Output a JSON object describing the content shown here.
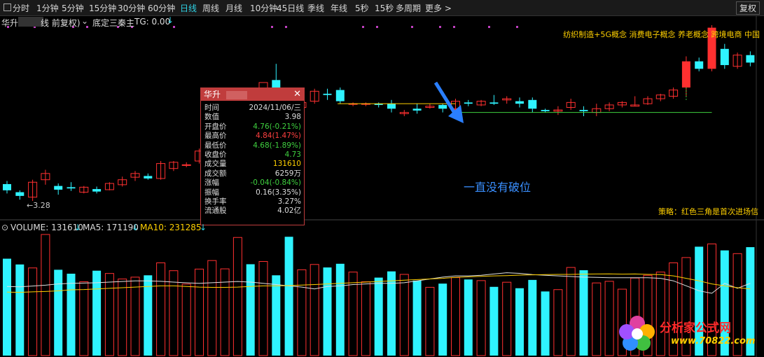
{
  "toolbar": {
    "periods": [
      "分时",
      "1分钟",
      "5分钟",
      "15分钟",
      "30分钟",
      "60分钟",
      "日线",
      "周线",
      "月线",
      "10分钟",
      "45日线",
      "季线",
      "年线",
      "5秒",
      "15秒",
      "多周期",
      "更多 >"
    ],
    "active": "日线",
    "right_button": "复权"
  },
  "header": {
    "name": "华升",
    "mode": "线 前复权)",
    "indicator": "底定三秦主",
    "tg": "TG: 0.00"
  },
  "concepts": "纺织制造+5G概念 消费电子概念 养老概念 跨境电商 中国",
  "strategy": "策略：红色三角是首次进场信",
  "annotation": "一直没有破位",
  "low_label": "3.28",
  "tooltip": {
    "title": "华升",
    "rows": [
      {
        "label": "时间",
        "value": "2024/11/06/三",
        "color": "#dddddd"
      },
      {
        "label": "数值",
        "value": "3.98",
        "color": "#dddddd"
      },
      {
        "label": "开盘价",
        "value": "4.76(-0.21%)",
        "color": "#3fd13f"
      },
      {
        "label": "最高价",
        "value": "4.84(1.47%)",
        "color": "#ff4040"
      },
      {
        "label": "最低价",
        "value": "4.68(-1.89%)",
        "color": "#3fd13f"
      },
      {
        "label": "收盘价",
        "value": "4.73",
        "color": "#3fd13f"
      },
      {
        "label": "成交量",
        "value": "131610",
        "color": "#ffd000"
      },
      {
        "label": "成交额",
        "value": "6259万",
        "color": "#dddddd"
      },
      {
        "label": "涨幅",
        "value": "-0.04(-0.84%)",
        "color": "#3fd13f"
      },
      {
        "label": "振幅",
        "value": "0.16(3.35%)",
        "color": "#dddddd"
      },
      {
        "label": "换手率",
        "value": "3.27%",
        "color": "#dddddd"
      },
      {
        "label": "流通股",
        "value": "4.02亿",
        "color": "#dddddd"
      }
    ]
  },
  "volume_header": {
    "volume": "VOLUME: 131610",
    "ma5": "MA5: 171190",
    "ma10": "MA10: 231285"
  },
  "logo": {
    "text": "分析家公式网",
    "url": "www.70822.com"
  },
  "colors": {
    "up": "#ff3030",
    "down": "#2ff3ff",
    "accent": "#2fd3e6",
    "yellow": "#ffd000"
  },
  "chart_data": {
    "type": "candlestick",
    "candles": [
      {
        "o": 3.55,
        "h": 3.6,
        "l": 3.4,
        "c": 3.45
      },
      {
        "o": 3.42,
        "h": 3.45,
        "l": 3.3,
        "c": 3.36
      },
      {
        "o": 3.34,
        "h": 3.62,
        "l": 3.28,
        "c": 3.58
      },
      {
        "o": 3.62,
        "h": 3.78,
        "l": 3.54,
        "c": 3.72
      },
      {
        "o": 3.52,
        "h": 3.56,
        "l": 3.38,
        "c": 3.46
      },
      {
        "o": 3.5,
        "h": 3.58,
        "l": 3.44,
        "c": 3.48
      },
      {
        "o": 3.42,
        "h": 3.52,
        "l": 3.4,
        "c": 3.5
      },
      {
        "o": 3.47,
        "h": 3.51,
        "l": 3.4,
        "c": 3.43
      },
      {
        "o": 3.46,
        "h": 3.58,
        "l": 3.45,
        "c": 3.56
      },
      {
        "o": 3.54,
        "h": 3.67,
        "l": 3.51,
        "c": 3.62
      },
      {
        "o": 3.66,
        "h": 3.76,
        "l": 3.6,
        "c": 3.72
      },
      {
        "o": 3.68,
        "h": 3.72,
        "l": 3.62,
        "c": 3.64
      },
      {
        "o": 3.64,
        "h": 3.92,
        "l": 3.62,
        "c": 3.88
      },
      {
        "o": 3.8,
        "h": 3.92,
        "l": 3.76,
        "c": 3.9
      },
      {
        "o": 3.86,
        "h": 3.9,
        "l": 3.82,
        "c": 3.86
      },
      {
        "o": 3.92,
        "h": 4.12,
        "l": 3.88,
        "c": 4.08
      },
      {
        "o": 4.35,
        "h": 4.62,
        "l": 4.3,
        "c": 4.56
      },
      {
        "o": 4.56,
        "h": 4.64,
        "l": 4.52,
        "c": 4.6
      },
      {
        "o": 4.6,
        "h": 4.98,
        "l": 4.56,
        "c": 4.92
      },
      {
        "o": 4.9,
        "h": 5.02,
        "l": 4.66,
        "c": 4.72
      },
      {
        "o": 4.68,
        "h": 5.02,
        "l": 4.5,
        "c": 5.18
      },
      {
        "o": 5.22,
        "h": 5.48,
        "l": 4.78,
        "c": 4.84
      },
      {
        "o": 4.8,
        "h": 4.86,
        "l": 4.7,
        "c": 4.74
      },
      {
        "o": 4.78,
        "h": 4.9,
        "l": 4.72,
        "c": 4.86
      },
      {
        "o": 4.88,
        "h": 5.08,
        "l": 4.84,
        "c": 5.04
      },
      {
        "o": 5.0,
        "h": 5.08,
        "l": 4.9,
        "c": 4.98
      },
      {
        "o": 5.06,
        "h": 5.1,
        "l": 4.84,
        "c": 4.88
      },
      {
        "o": 4.84,
        "h": 4.86,
        "l": 4.8,
        "c": 4.84
      },
      {
        "o": 4.84,
        "h": 4.86,
        "l": 4.8,
        "c": 4.84
      },
      {
        "o": 4.84,
        "h": 4.86,
        "l": 4.78,
        "c": 4.82
      },
      {
        "o": 4.84,
        "h": 4.9,
        "l": 4.7,
        "c": 4.76
      },
      {
        "o": 4.68,
        "h": 4.74,
        "l": 4.64,
        "c": 4.7
      },
      {
        "o": 4.76,
        "h": 4.84,
        "l": 4.68,
        "c": 4.73
      },
      {
        "o": 4.78,
        "h": 4.84,
        "l": 4.76,
        "c": 4.8
      },
      {
        "o": 4.82,
        "h": 4.84,
        "l": 4.7,
        "c": 4.76
      },
      {
        "o": 4.76,
        "h": 4.92,
        "l": 4.74,
        "c": 4.88
      },
      {
        "o": 4.86,
        "h": 4.9,
        "l": 4.8,
        "c": 4.84
      },
      {
        "o": 4.82,
        "h": 4.9,
        "l": 4.8,
        "c": 4.88
      },
      {
        "o": 4.86,
        "h": 4.98,
        "l": 4.82,
        "c": 4.84
      },
      {
        "o": 4.9,
        "h": 4.96,
        "l": 4.84,
        "c": 4.92
      },
      {
        "o": 4.88,
        "h": 4.94,
        "l": 4.78,
        "c": 4.84
      },
      {
        "o": 4.9,
        "h": 4.94,
        "l": 4.7,
        "c": 4.76
      },
      {
        "o": 4.74,
        "h": 4.76,
        "l": 4.7,
        "c": 4.72
      },
      {
        "o": 4.72,
        "h": 4.8,
        "l": 4.66,
        "c": 4.74
      },
      {
        "o": 4.78,
        "h": 4.92,
        "l": 4.74,
        "c": 4.86
      },
      {
        "o": 4.74,
        "h": 4.8,
        "l": 4.64,
        "c": 4.72
      },
      {
        "o": 4.7,
        "h": 4.84,
        "l": 4.64,
        "c": 4.76
      },
      {
        "o": 4.76,
        "h": 4.86,
        "l": 4.72,
        "c": 4.82
      },
      {
        "o": 4.82,
        "h": 4.88,
        "l": 4.78,
        "c": 4.86
      },
      {
        "o": 4.8,
        "h": 4.96,
        "l": 4.8,
        "c": 4.82
      },
      {
        "o": 4.84,
        "h": 4.96,
        "l": 4.82,
        "c": 4.92
      },
      {
        "o": 4.92,
        "h": 5.0,
        "l": 4.88,
        "c": 4.98
      },
      {
        "o": 4.96,
        "h": 5.1,
        "l": 4.92,
        "c": 5.06
      },
      {
        "o": 5.1,
        "h": 5.6,
        "l": 4.96,
        "c": 5.52
      },
      {
        "o": 5.52,
        "h": 5.58,
        "l": 5.36,
        "c": 5.4
      },
      {
        "o": 5.4,
        "h": 6.1,
        "l": 5.36,
        "c": 6.06
      },
      {
        "o": 5.72,
        "h": 5.8,
        "l": 5.4,
        "c": 5.46
      },
      {
        "o": 5.44,
        "h": 5.66,
        "l": 5.4,
        "c": 5.62
      },
      {
        "o": 5.62,
        "h": 5.68,
        "l": 5.44,
        "c": 5.5
      }
    ],
    "volume": [
      420,
      395,
      380,
      525,
      372,
      355,
      320,
      368,
      356,
      332,
      340,
      348,
      402,
      368,
      310,
      375,
      412,
      376,
      512,
      396,
      408,
      348,
      515,
      372,
      395,
      382,
      398,
      362,
      320,
      338,
      365,
      352,
      325,
      296,
      312,
      338,
      330,
      325,
      298,
      318,
      292,
      328,
      278,
      286,
      382,
      370,
      315,
      322,
      288,
      336,
      348,
      362,
      402,
      425,
      472,
      484,
      456,
      442,
      470
    ],
    "ma5": [
      0.555,
      0.552,
      0.558,
      0.565,
      0.575,
      0.58,
      0.582,
      0.585,
      0.59,
      0.595,
      0.6,
      0.6,
      0.596,
      0.59,
      0.584,
      0.58,
      0.585,
      0.59,
      0.595,
      0.59,
      0.58,
      0.57,
      0.56,
      0.55,
      0.535,
      0.555,
      0.56,
      0.57,
      0.575,
      0.58,
      0.58,
      0.585,
      0.6,
      0.615,
      0.63,
      0.64,
      0.64,
      0.645,
      0.655,
      0.665,
      0.66,
      0.65,
      0.645,
      0.64,
      0.635,
      0.63,
      0.628,
      0.625,
      0.625,
      0.625,
      0.625,
      0.62,
      0.6,
      0.56,
      0.52,
      0.5,
      0.58,
      0.54,
      0.58
    ],
    "ma10": [
      0.51,
      0.508,
      0.512,
      0.515,
      0.52,
      0.528,
      0.53,
      0.535,
      0.54,
      0.545,
      0.55,
      0.555,
      0.56,
      0.56,
      0.555,
      0.55,
      0.548,
      0.548,
      0.55,
      0.555,
      0.56,
      0.56,
      0.562,
      0.566,
      0.57,
      0.575,
      0.58,
      0.585,
      0.59,
      0.595,
      0.6,
      0.605,
      0.61,
      0.615,
      0.62,
      0.628,
      0.632,
      0.636,
      0.64,
      0.642,
      0.646,
      0.648,
      0.65,
      0.652,
      0.652,
      0.654,
      0.655,
      0.656,
      0.654,
      0.655,
      0.652,
      0.65,
      0.64,
      0.62,
      0.6,
      0.575,
      0.56,
      0.545,
      0.535
    ]
  }
}
